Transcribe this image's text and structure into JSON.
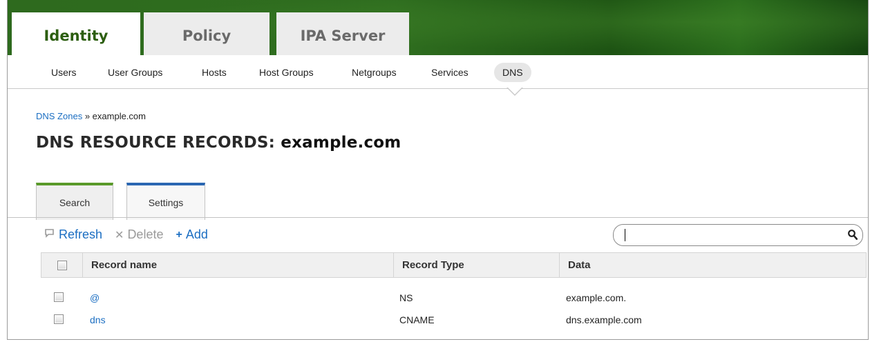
{
  "top_tabs": {
    "identity": "Identity",
    "policy": "Policy",
    "ipa_server": "IPA Server"
  },
  "subnav": {
    "users": "Users",
    "user_groups": "User Groups",
    "hosts": "Hosts",
    "host_groups": "Host Groups",
    "netgroups": "Netgroups",
    "services": "Services",
    "dns": "DNS"
  },
  "breadcrumb": {
    "parent": "DNS Zones",
    "separator": " » ",
    "current": "example.com"
  },
  "title": {
    "prefix": "DNS RESOURCE RECORDS: ",
    "zone": "example.com"
  },
  "facets": {
    "search": "Search",
    "settings": "Settings"
  },
  "toolbar": {
    "refresh": "Refresh",
    "delete": "Delete",
    "add": "Add"
  },
  "search": {
    "value": ""
  },
  "table": {
    "columns": {
      "record_name": "Record name",
      "record_type": "Record Type",
      "data": "Data"
    },
    "rows": [
      {
        "name": "@",
        "type": "NS",
        "data": "example.com."
      },
      {
        "name": "dns",
        "type": "CNAME",
        "data": "dns.example.com"
      }
    ]
  },
  "colors": {
    "header_green": "#2e6a1e",
    "link_blue": "#1b6ec2",
    "search_tab_accent": "#5a9a2a",
    "settings_tab_accent": "#2a66b2"
  }
}
